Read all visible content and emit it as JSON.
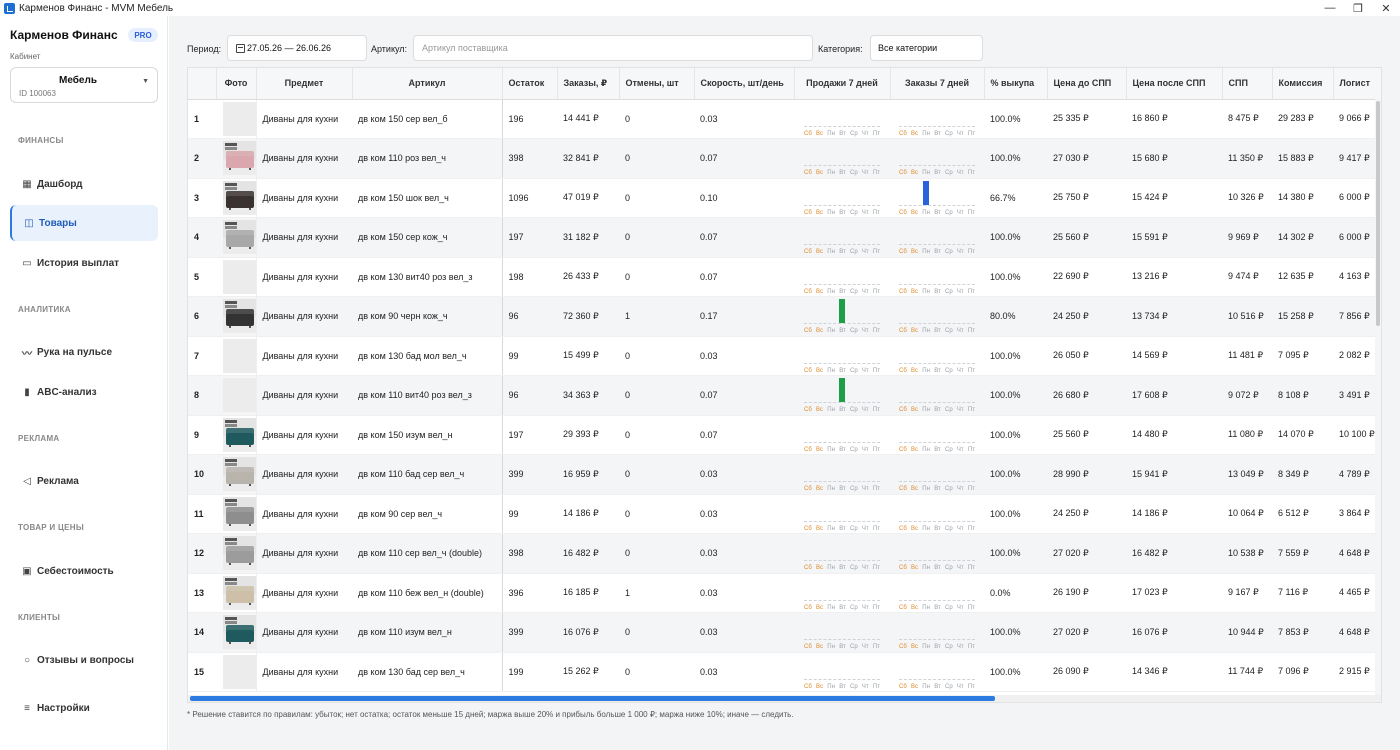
{
  "window": {
    "title": "Карменов Финанс - MVM Мебель",
    "minimize": "—",
    "maximize": "❐",
    "close": "✕"
  },
  "sidebar": {
    "brand": "Карменов Финанс",
    "badge": "PRO",
    "cabinet_label": "Кабинет",
    "cabinet_name": "Мебель",
    "cabinet_id": "ID 100063",
    "sections": {
      "finance": "ФИНАНСЫ",
      "analytics": "АНАЛИТИКА",
      "ads": "РЕКЛАМА",
      "goods_prices": "ТОВАР И ЦЕНЫ",
      "clients": "КЛИЕНТЫ"
    },
    "items": {
      "dashboard": "Дашборд",
      "goods": "Товары",
      "payouts": "История выплат",
      "pulse": "Рука на пульсе",
      "abc": "ABC-анализ",
      "ads": "Реклама",
      "cost": "Себестоимость",
      "reviews": "Отзывы и вопросы",
      "settings": "Настройки"
    },
    "active_item": "goods"
  },
  "filters": {
    "period_label": "Период:",
    "period_value": "27.05.26 — 26.06.26",
    "article_label": "Артикул:",
    "article_placeholder": "Артикул поставщика",
    "category_label": "Категория:",
    "category_value": "Все категории"
  },
  "table": {
    "headers": [
      "",
      "Фото",
      "Предмет",
      "Артикул",
      "Остаток",
      "Заказы, ₽",
      "Отмены, шт",
      "Скорость, шт/день",
      "Продажи 7 дней",
      "Заказы 7 дней",
      "% выкупа",
      "Цена до СПП",
      "Цена после СПП",
      "СПП",
      "Комиссия",
      "Логист"
    ],
    "day_labels": [
      "Сб",
      "Вс",
      "Пн",
      "Вт",
      "Ср",
      "Чт",
      "Пт"
    ],
    "rows": [
      {
        "n": "1",
        "photo": false,
        "subject": "Диваны для кухни",
        "article": "дв ком 150 сер вел_б",
        "stock": "196",
        "orders": "14 441 ₽",
        "cancels": "0",
        "speed": "0.03",
        "sales7": [
          0,
          0,
          0,
          0,
          0,
          0,
          0
        ],
        "orders7": [
          0,
          0,
          0,
          0,
          0,
          0,
          0
        ],
        "buyout": "100.0%",
        "price_before": "25 335 ₽",
        "price_after": "16 860 ₽",
        "spp": "8 475 ₽",
        "commission": "29 283 ₽",
        "logistics": "9 066 ₽"
      },
      {
        "n": "2",
        "photo": true,
        "color": "#d9a7ad",
        "subject": "Диваны для кухни",
        "article": "дв ком 110 роз вел_ч",
        "stock": "398",
        "orders": "32 841 ₽",
        "cancels": "0",
        "speed": "0.07",
        "sales7": [
          0,
          0,
          0,
          0,
          0,
          0,
          0
        ],
        "orders7": [
          0,
          0,
          0,
          0,
          0,
          0,
          0
        ],
        "buyout": "100.0%",
        "price_before": "27 030 ₽",
        "price_after": "15 680 ₽",
        "spp": "11 350 ₽",
        "commission": "15 883 ₽",
        "logistics": "9 417 ₽"
      },
      {
        "n": "3",
        "photo": true,
        "color": "#3a3230",
        "subject": "Диваны для кухни",
        "article": "дв ком 150 шок вел_ч",
        "stock": "1096",
        "orders": "47 019 ₽",
        "cancels": "0",
        "speed": "0.10",
        "sales7": [
          0,
          0,
          0,
          0,
          0,
          0,
          0
        ],
        "orders7": [
          0,
          0,
          1,
          0,
          0,
          0,
          0
        ],
        "buyout": "66.7%",
        "price_before": "25 750 ₽",
        "price_after": "15 424 ₽",
        "spp": "10 326 ₽",
        "commission": "14 380 ₽",
        "logistics": "6 000 ₽"
      },
      {
        "n": "4",
        "photo": true,
        "color": "#a8a8a8",
        "subject": "Диваны для кухни",
        "article": "дв ком 150 сер кож_ч",
        "stock": "197",
        "orders": "31 182 ₽",
        "cancels": "0",
        "speed": "0.07",
        "sales7": [
          0,
          0,
          0,
          0,
          0,
          0,
          0
        ],
        "orders7": [
          0,
          0,
          0,
          0,
          0,
          0,
          0
        ],
        "buyout": "100.0%",
        "price_before": "25 560 ₽",
        "price_after": "15 591 ₽",
        "spp": "9 969 ₽",
        "commission": "14 302 ₽",
        "logistics": "6 000 ₽"
      },
      {
        "n": "5",
        "photo": false,
        "subject": "Диваны для кухни",
        "article": "дв ком 130 вит40 роз вел_з",
        "stock": "198",
        "orders": "26 433 ₽",
        "cancels": "0",
        "speed": "0.07",
        "sales7": [
          0,
          0,
          0,
          0,
          0,
          0,
          0
        ],
        "orders7": [
          0,
          0,
          0,
          0,
          0,
          0,
          0
        ],
        "buyout": "100.0%",
        "price_before": "22 690 ₽",
        "price_after": "13 216 ₽",
        "spp": "9 474 ₽",
        "commission": "12 635 ₽",
        "logistics": "4 163 ₽"
      },
      {
        "n": "6",
        "photo": true,
        "color": "#333333",
        "subject": "Диваны для кухни",
        "article": "дв ком 90 черн кож_ч",
        "stock": "96",
        "orders": "72 360 ₽",
        "cancels": "1",
        "speed": "0.17",
        "sales7": [
          0,
          0,
          0,
          1,
          0,
          0,
          0
        ],
        "orders7": [
          0,
          0,
          0,
          0,
          0,
          0,
          0
        ],
        "buyout": "80.0%",
        "price_before": "24 250 ₽",
        "price_after": "13 734 ₽",
        "spp": "10 516 ₽",
        "commission": "15 258 ₽",
        "logistics": "7 856 ₽"
      },
      {
        "n": "7",
        "photo": false,
        "subject": "Диваны для кухни",
        "article": "дв ком 130 бад мол вел_ч",
        "stock": "99",
        "orders": "15 499 ₽",
        "cancels": "0",
        "speed": "0.03",
        "sales7": [
          0,
          0,
          0,
          0,
          0,
          0,
          0
        ],
        "orders7": [
          0,
          0,
          0,
          0,
          0,
          0,
          0
        ],
        "buyout": "100.0%",
        "price_before": "26 050 ₽",
        "price_after": "14 569 ₽",
        "spp": "11 481 ₽",
        "commission": "7 095 ₽",
        "logistics": "2 082 ₽"
      },
      {
        "n": "8",
        "photo": false,
        "subject": "Диваны для кухни",
        "article": "дв ком 110 вит40 роз вел_з",
        "stock": "96",
        "orders": "34 363 ₽",
        "cancels": "0",
        "speed": "0.07",
        "sales7": [
          0,
          0,
          0,
          1,
          0,
          0,
          0
        ],
        "orders7": [
          0,
          0,
          0,
          0,
          0,
          0,
          0
        ],
        "buyout": "100.0%",
        "price_before": "26 680 ₽",
        "price_after": "17 608 ₽",
        "spp": "9 072 ₽",
        "commission": "8 108 ₽",
        "logistics": "3 491 ₽"
      },
      {
        "n": "9",
        "photo": true,
        "color": "#1f5a5e",
        "subject": "Диваны для кухни",
        "article": "дв ком 150 изум вел_н",
        "stock": "197",
        "orders": "29 393 ₽",
        "cancels": "0",
        "speed": "0.07",
        "sales7": [
          0,
          0,
          0,
          0,
          0,
          0,
          0
        ],
        "orders7": [
          0,
          0,
          0,
          0,
          0,
          0,
          0
        ],
        "buyout": "100.0%",
        "price_before": "25 560 ₽",
        "price_after": "14 480 ₽",
        "spp": "11 080 ₽",
        "commission": "14 070 ₽",
        "logistics": "10 100 ₽"
      },
      {
        "n": "10",
        "photo": true,
        "color": "#b9b4ab",
        "subject": "Диваны для кухни",
        "article": "дв ком 110 бад сер вел_ч",
        "stock": "399",
        "orders": "16 959 ₽",
        "cancels": "0",
        "speed": "0.03",
        "sales7": [
          0,
          0,
          0,
          0,
          0,
          0,
          0
        ],
        "orders7": [
          0,
          0,
          0,
          0,
          0,
          0,
          0
        ],
        "buyout": "100.0%",
        "price_before": "28 990 ₽",
        "price_after": "15 941 ₽",
        "spp": "13 049 ₽",
        "commission": "8 349 ₽",
        "logistics": "4 789 ₽"
      },
      {
        "n": "11",
        "photo": true,
        "color": "#8e8e8e",
        "subject": "Диваны для кухни",
        "article": "дв ком 90 сер вел_ч",
        "stock": "99",
        "orders": "14 186 ₽",
        "cancels": "0",
        "speed": "0.03",
        "sales7": [
          0,
          0,
          0,
          0,
          0,
          0,
          0
        ],
        "orders7": [
          0,
          0,
          0,
          0,
          0,
          0,
          0
        ],
        "buyout": "100.0%",
        "price_before": "24 250 ₽",
        "price_after": "14 186 ₽",
        "spp": "10 064 ₽",
        "commission": "6 512 ₽",
        "logistics": "3 864 ₽"
      },
      {
        "n": "12",
        "photo": true,
        "color": "#9c9c9c",
        "subject": "Диваны для кухни",
        "article": "дв ком 110 сер вел_ч (double)",
        "stock": "398",
        "orders": "16 482 ₽",
        "cancels": "0",
        "speed": "0.03",
        "sales7": [
          0,
          0,
          0,
          0,
          0,
          0,
          0
        ],
        "orders7": [
          0,
          0,
          0,
          0,
          0,
          0,
          0
        ],
        "buyout": "100.0%",
        "price_before": "27 020 ₽",
        "price_after": "16 482 ₽",
        "spp": "10 538 ₽",
        "commission": "7 559 ₽",
        "logistics": "4 648 ₽"
      },
      {
        "n": "13",
        "photo": true,
        "color": "#cdbfa8",
        "subject": "Диваны для кухни",
        "article": "дв ком 110 беж вел_н (double)",
        "stock": "396",
        "orders": "16 185 ₽",
        "cancels": "1",
        "speed": "0.03",
        "sales7": [
          0,
          0,
          0,
          0,
          0,
          0,
          0
        ],
        "orders7": [
          0,
          0,
          0,
          0,
          0,
          0,
          0
        ],
        "buyout": "0.0%",
        "price_before": "26 190 ₽",
        "price_after": "17 023 ₽",
        "spp": "9 167 ₽",
        "commission": "7 116 ₽",
        "logistics": "4 465 ₽"
      },
      {
        "n": "14",
        "photo": true,
        "color": "#1f5a5e",
        "subject": "Диваны для кухни",
        "article": "дв ком 110 изум вел_н",
        "stock": "399",
        "orders": "16 076 ₽",
        "cancels": "0",
        "speed": "0.03",
        "sales7": [
          0,
          0,
          0,
          0,
          0,
          0,
          0
        ],
        "orders7": [
          0,
          0,
          0,
          0,
          0,
          0,
          0
        ],
        "buyout": "100.0%",
        "price_before": "27 020 ₽",
        "price_after": "16 076 ₽",
        "spp": "10 944 ₽",
        "commission": "7 853 ₽",
        "logistics": "4 648 ₽"
      },
      {
        "n": "15",
        "photo": false,
        "subject": "Диваны для кухни",
        "article": "дв ком 130 бад сер вел_ч",
        "stock": "199",
        "orders": "15 262 ₽",
        "cancels": "0",
        "speed": "0.03",
        "sales7": [
          0,
          0,
          0,
          0,
          0,
          0,
          0
        ],
        "orders7": [
          0,
          0,
          0,
          0,
          0,
          0,
          0
        ],
        "buyout": "100.0%",
        "price_before": "26 090 ₽",
        "price_after": "14 346 ₽",
        "spp": "11 744 ₽",
        "commission": "7 096 ₽",
        "logistics": "2 915 ₽"
      }
    ]
  },
  "footnote": "* Решение ставится по правилам: убыток; нет остатка; остаток меньше 15 дней; маржа выше 20% и прибыль больше 1 000 ₽; маржа ниже 10%; иначе — следить.",
  "colors": {
    "accent": "#2d7be0",
    "sales_bar": "#1e9e47",
    "orders_bar": "#2a63d9",
    "weekend_label": "#e08a2a"
  },
  "icons": {
    "dashboard": "dashboard-icon",
    "goods": "box-icon",
    "payouts": "wallet-icon",
    "pulse": "pulse-icon",
    "abc": "bar-chart-icon",
    "ads": "megaphone-icon",
    "cost": "ledger-icon",
    "reviews": "chat-icon",
    "settings": "sliders-icon",
    "calendar": "calendar-icon"
  }
}
